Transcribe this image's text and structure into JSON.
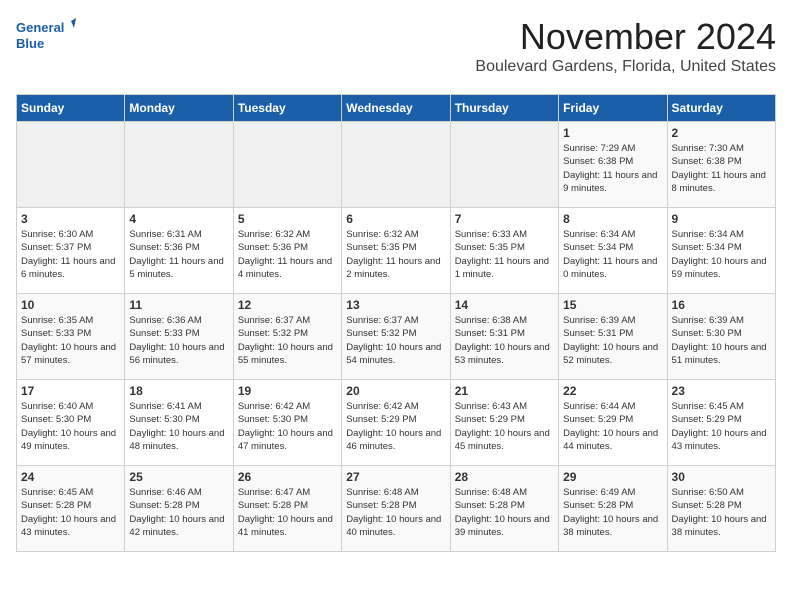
{
  "logo": {
    "line1": "General",
    "line2": "Blue"
  },
  "title": "November 2024",
  "subtitle": "Boulevard Gardens, Florida, United States",
  "days_of_week": [
    "Sunday",
    "Monday",
    "Tuesday",
    "Wednesday",
    "Thursday",
    "Friday",
    "Saturday"
  ],
  "weeks": [
    [
      {
        "day": "",
        "info": ""
      },
      {
        "day": "",
        "info": ""
      },
      {
        "day": "",
        "info": ""
      },
      {
        "day": "",
        "info": ""
      },
      {
        "day": "",
        "info": ""
      },
      {
        "day": "1",
        "info": "Sunrise: 7:29 AM\nSunset: 6:38 PM\nDaylight: 11 hours and 9 minutes."
      },
      {
        "day": "2",
        "info": "Sunrise: 7:30 AM\nSunset: 6:38 PM\nDaylight: 11 hours and 8 minutes."
      }
    ],
    [
      {
        "day": "3",
        "info": "Sunrise: 6:30 AM\nSunset: 5:37 PM\nDaylight: 11 hours and 6 minutes."
      },
      {
        "day": "4",
        "info": "Sunrise: 6:31 AM\nSunset: 5:36 PM\nDaylight: 11 hours and 5 minutes."
      },
      {
        "day": "5",
        "info": "Sunrise: 6:32 AM\nSunset: 5:36 PM\nDaylight: 11 hours and 4 minutes."
      },
      {
        "day": "6",
        "info": "Sunrise: 6:32 AM\nSunset: 5:35 PM\nDaylight: 11 hours and 2 minutes."
      },
      {
        "day": "7",
        "info": "Sunrise: 6:33 AM\nSunset: 5:35 PM\nDaylight: 11 hours and 1 minute."
      },
      {
        "day": "8",
        "info": "Sunrise: 6:34 AM\nSunset: 5:34 PM\nDaylight: 11 hours and 0 minutes."
      },
      {
        "day": "9",
        "info": "Sunrise: 6:34 AM\nSunset: 5:34 PM\nDaylight: 10 hours and 59 minutes."
      }
    ],
    [
      {
        "day": "10",
        "info": "Sunrise: 6:35 AM\nSunset: 5:33 PM\nDaylight: 10 hours and 57 minutes."
      },
      {
        "day": "11",
        "info": "Sunrise: 6:36 AM\nSunset: 5:33 PM\nDaylight: 10 hours and 56 minutes."
      },
      {
        "day": "12",
        "info": "Sunrise: 6:37 AM\nSunset: 5:32 PM\nDaylight: 10 hours and 55 minutes."
      },
      {
        "day": "13",
        "info": "Sunrise: 6:37 AM\nSunset: 5:32 PM\nDaylight: 10 hours and 54 minutes."
      },
      {
        "day": "14",
        "info": "Sunrise: 6:38 AM\nSunset: 5:31 PM\nDaylight: 10 hours and 53 minutes."
      },
      {
        "day": "15",
        "info": "Sunrise: 6:39 AM\nSunset: 5:31 PM\nDaylight: 10 hours and 52 minutes."
      },
      {
        "day": "16",
        "info": "Sunrise: 6:39 AM\nSunset: 5:30 PM\nDaylight: 10 hours and 51 minutes."
      }
    ],
    [
      {
        "day": "17",
        "info": "Sunrise: 6:40 AM\nSunset: 5:30 PM\nDaylight: 10 hours and 49 minutes."
      },
      {
        "day": "18",
        "info": "Sunrise: 6:41 AM\nSunset: 5:30 PM\nDaylight: 10 hours and 48 minutes."
      },
      {
        "day": "19",
        "info": "Sunrise: 6:42 AM\nSunset: 5:30 PM\nDaylight: 10 hours and 47 minutes."
      },
      {
        "day": "20",
        "info": "Sunrise: 6:42 AM\nSunset: 5:29 PM\nDaylight: 10 hours and 46 minutes."
      },
      {
        "day": "21",
        "info": "Sunrise: 6:43 AM\nSunset: 5:29 PM\nDaylight: 10 hours and 45 minutes."
      },
      {
        "day": "22",
        "info": "Sunrise: 6:44 AM\nSunset: 5:29 PM\nDaylight: 10 hours and 44 minutes."
      },
      {
        "day": "23",
        "info": "Sunrise: 6:45 AM\nSunset: 5:29 PM\nDaylight: 10 hours and 43 minutes."
      }
    ],
    [
      {
        "day": "24",
        "info": "Sunrise: 6:45 AM\nSunset: 5:28 PM\nDaylight: 10 hours and 43 minutes."
      },
      {
        "day": "25",
        "info": "Sunrise: 6:46 AM\nSunset: 5:28 PM\nDaylight: 10 hours and 42 minutes."
      },
      {
        "day": "26",
        "info": "Sunrise: 6:47 AM\nSunset: 5:28 PM\nDaylight: 10 hours and 41 minutes."
      },
      {
        "day": "27",
        "info": "Sunrise: 6:48 AM\nSunset: 5:28 PM\nDaylight: 10 hours and 40 minutes."
      },
      {
        "day": "28",
        "info": "Sunrise: 6:48 AM\nSunset: 5:28 PM\nDaylight: 10 hours and 39 minutes."
      },
      {
        "day": "29",
        "info": "Sunrise: 6:49 AM\nSunset: 5:28 PM\nDaylight: 10 hours and 38 minutes."
      },
      {
        "day": "30",
        "info": "Sunrise: 6:50 AM\nSunset: 5:28 PM\nDaylight: 10 hours and 38 minutes."
      }
    ]
  ]
}
